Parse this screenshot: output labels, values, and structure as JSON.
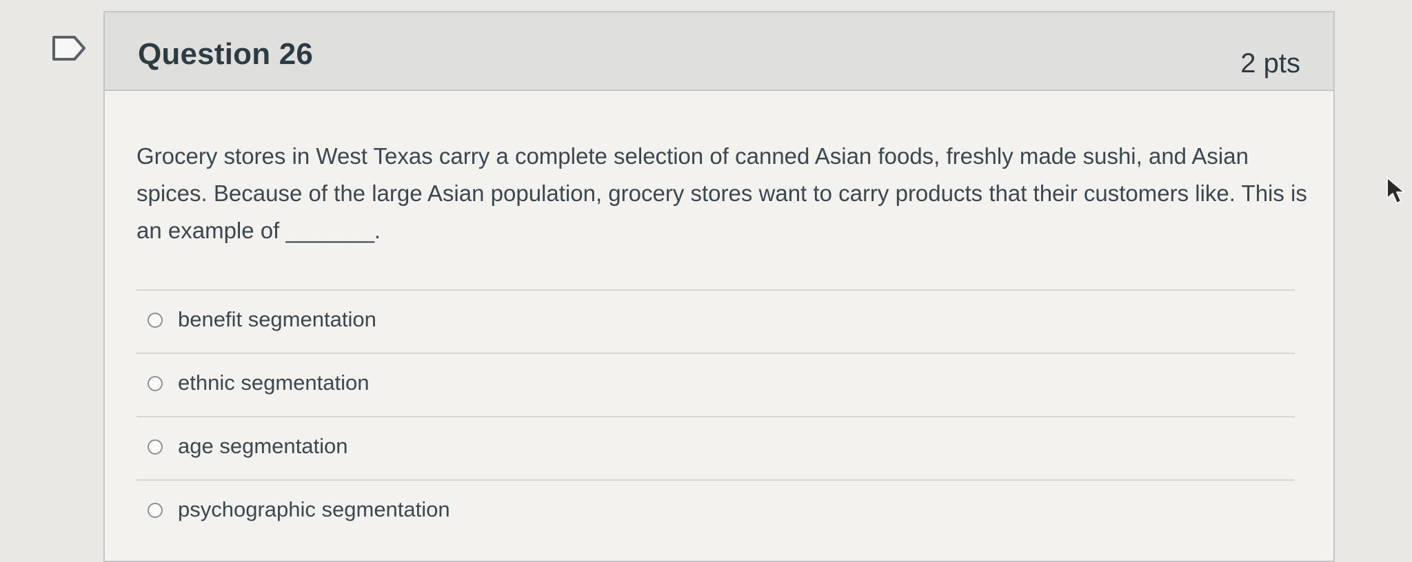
{
  "question": {
    "title": "Question 26",
    "points": "2 pts",
    "text": "Grocery stores in West Texas carry a complete selection of canned Asian foods, freshly made sushi, and Asian spices. Because of the large Asian population, grocery stores want to carry products that their customers like. This is an example of _______.",
    "answers": [
      {
        "label": "benefit segmentation",
        "selected": false
      },
      {
        "label": "ethnic segmentation",
        "selected": false
      },
      {
        "label": "age segmentation",
        "selected": false
      },
      {
        "label": "psychographic segmentation",
        "selected": false
      }
    ]
  },
  "icons": {
    "flag": "flag-question-icon",
    "cursor": "mouse-pointer-icon",
    "radio": "radio-button-icon"
  },
  "colors": {
    "header_bg": "#dfdfdd",
    "card_bg": "#f3f2ef",
    "text": "#2d3b45",
    "border": "#c4c6c8"
  }
}
